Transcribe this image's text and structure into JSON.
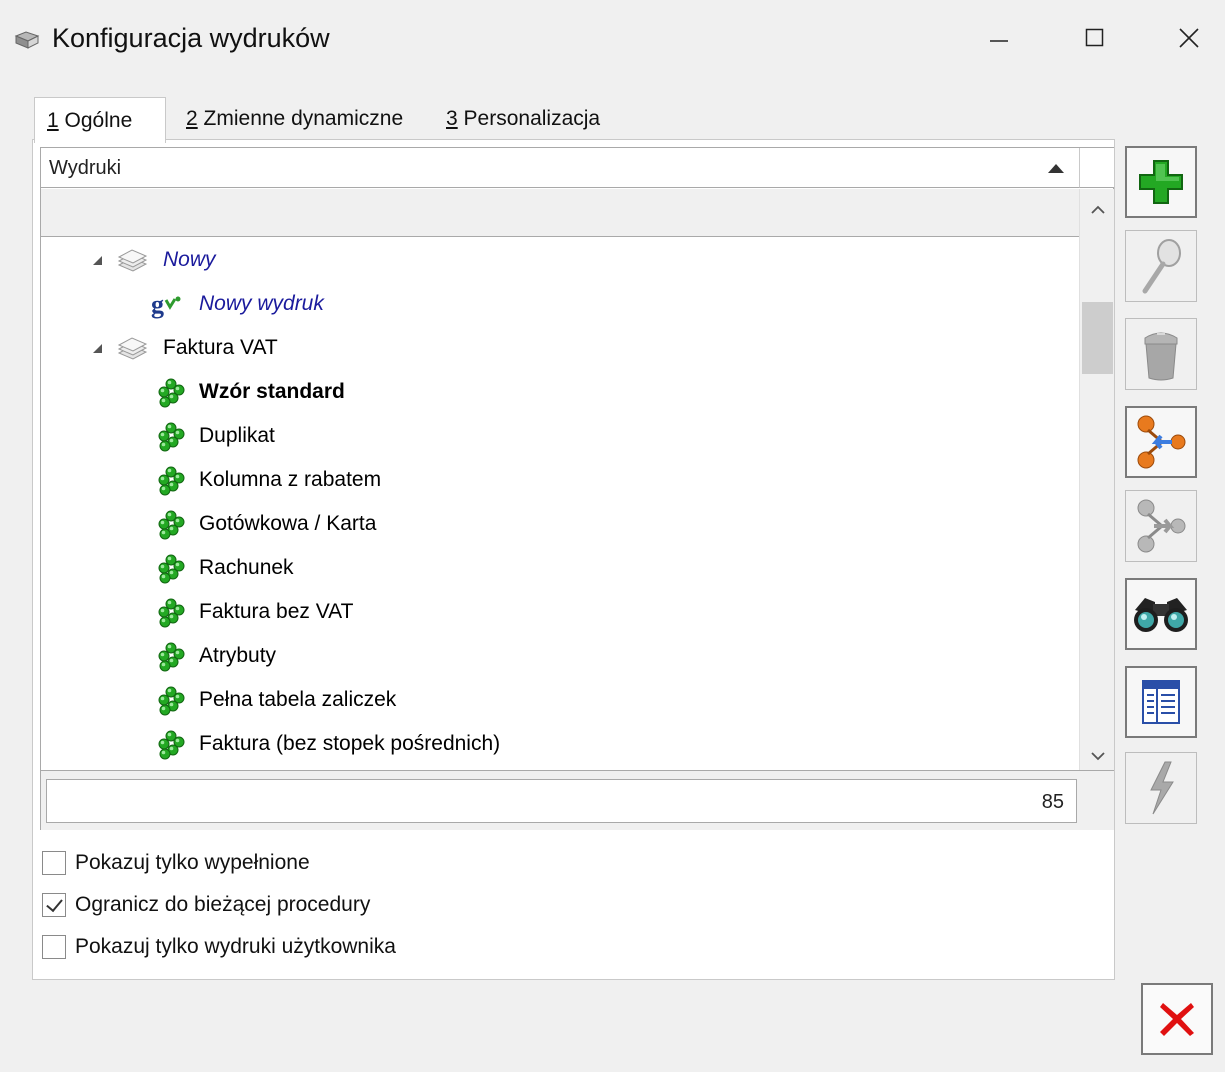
{
  "window": {
    "title": "Konfiguracja wydruków",
    "icons": {
      "app": "printer-config-icon",
      "minimize": "minimize-icon",
      "maximize": "maximize-icon",
      "close": "close-icon"
    }
  },
  "tabs": [
    {
      "key": "1",
      "label": "Ogólne",
      "active": true
    },
    {
      "key": "2",
      "label": "Zmienne dynamiczne",
      "active": false
    },
    {
      "key": "3",
      "label": "Personalizacja",
      "active": false
    }
  ],
  "grid": {
    "column_header": "Wydruki",
    "sort": "ascending",
    "tree": [
      {
        "label": "Nowy",
        "type": "group",
        "style": "italic-blue",
        "expanded": true
      },
      {
        "label": "Nowy wydruk",
        "type": "item",
        "style": "italic-blue",
        "icon": "gv-icon"
      },
      {
        "label": "Faktura VAT",
        "type": "group",
        "style": "normal",
        "expanded": true
      },
      {
        "label": "Wzór standard",
        "type": "item",
        "style": "bold",
        "icon": "green-clover-icon"
      },
      {
        "label": "Duplikat",
        "type": "item",
        "style": "normal",
        "icon": "green-clover-icon"
      },
      {
        "label": "Kolumna z rabatem",
        "type": "item",
        "style": "normal",
        "icon": "green-clover-icon"
      },
      {
        "label": "Gotówkowa / Karta",
        "type": "item",
        "style": "normal",
        "icon": "green-clover-icon"
      },
      {
        "label": "Rachunek",
        "type": "item",
        "style": "normal",
        "icon": "green-clover-icon"
      },
      {
        "label": "Faktura bez VAT",
        "type": "item",
        "style": "normal",
        "icon": "green-clover-icon"
      },
      {
        "label": "Atrybuty",
        "type": "item",
        "style": "normal",
        "icon": "green-clover-icon"
      },
      {
        "label": "Pełna tabela zaliczek",
        "type": "item",
        "style": "normal",
        "icon": "green-clover-icon"
      },
      {
        "label": "Faktura (bez stopek pośrednich)",
        "type": "item",
        "style": "normal",
        "icon": "green-clover-icon"
      }
    ],
    "count": "85"
  },
  "options": [
    {
      "label": "Pokazuj tylko wypełnione",
      "checked": false
    },
    {
      "label": "Ogranicz do bieżącej procedury",
      "checked": true
    },
    {
      "label": "Pokazuj tylko wydruki użytkownika",
      "checked": false
    }
  ],
  "toolbar": [
    {
      "name": "add-icon",
      "enabled": true
    },
    {
      "name": "magnifier-icon",
      "enabled": false
    },
    {
      "name": "trash-icon",
      "enabled": false
    },
    {
      "name": "copy-print-icon",
      "enabled": true
    },
    {
      "name": "paste-print-icon",
      "enabled": false
    },
    {
      "name": "binoculars-icon",
      "enabled": true
    },
    {
      "name": "table-columns-icon",
      "enabled": true
    },
    {
      "name": "lightning-icon",
      "enabled": false
    }
  ],
  "colors": {
    "accent_green": "#23a823",
    "italic_blue": "#1a1a9c",
    "close_red": "#e01010"
  }
}
